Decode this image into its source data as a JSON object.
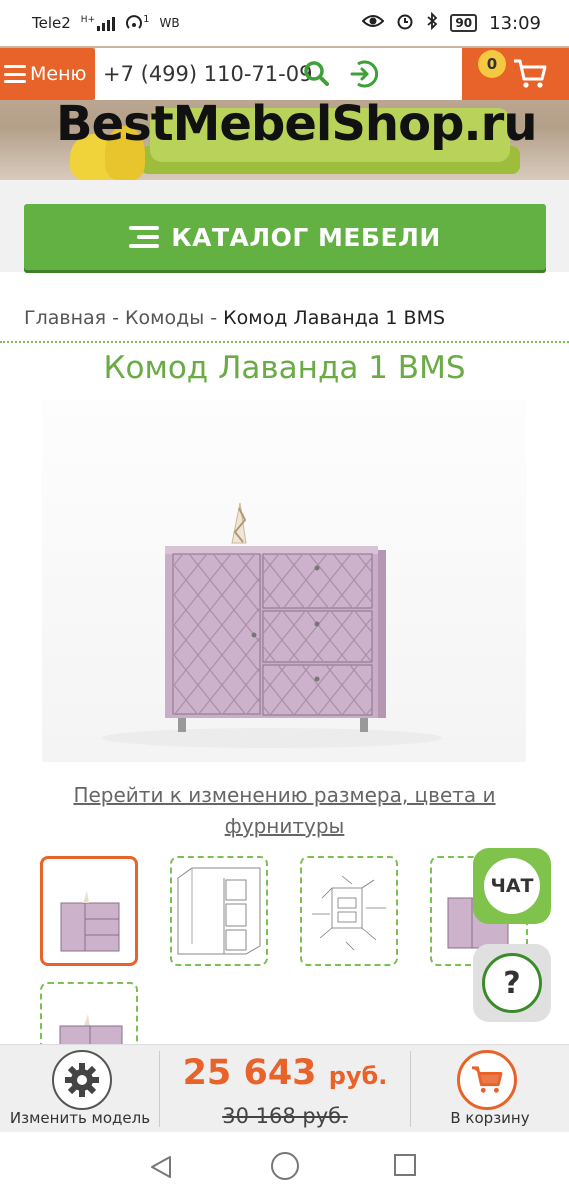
{
  "status_bar": {
    "carrier": "Tele2",
    "net": "H+",
    "hotspot_count": "1",
    "wb": "WB",
    "battery": "90",
    "time": "13:09"
  },
  "header": {
    "menu_label": "Меню",
    "phone": "+7 (499) 110-71-09",
    "cart_count": "0",
    "brand": "BestMebelShop.ru",
    "accent_color": "#e8632a",
    "green_color": "#62b142"
  },
  "catalog_button": "КАТАЛОГ МЕБЕЛИ",
  "breadcrumb": {
    "home": "Главная",
    "sep": " - ",
    "category": "Комоды",
    "current": "Комод Лаванда 1 BMS"
  },
  "product": {
    "title": "Комод Лаванда 1 BMS",
    "change_link": "Перейти к изменению размера, цвета и фурнитуры"
  },
  "widgets": {
    "chat": "ЧАТ",
    "help": "?"
  },
  "bottom_bar": {
    "change_model": "Изменить модель",
    "price": "25 643",
    "price_currency": "руб.",
    "old_price": "30 168 руб.",
    "to_cart": "В корзину"
  }
}
